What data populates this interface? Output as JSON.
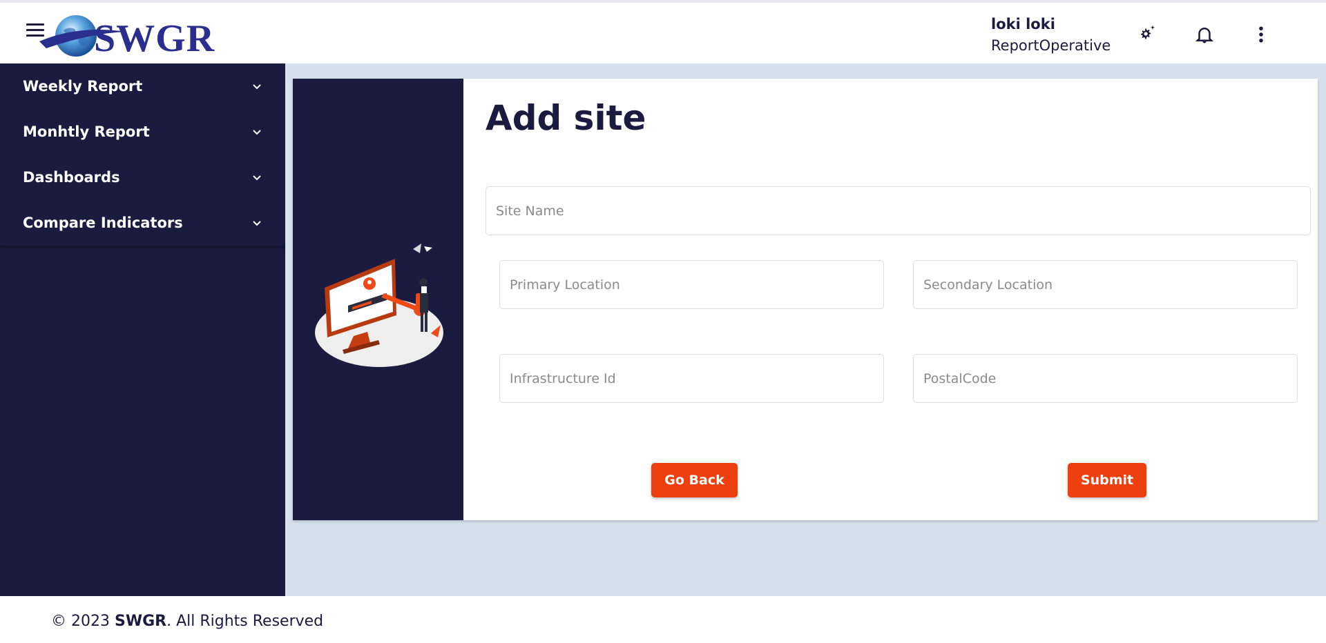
{
  "header": {
    "logo_text": "SWGR",
    "user_name": "loki loki",
    "user_role": "ReportOperative",
    "icons": [
      "menu-icon",
      "settings-icon",
      "notification-bell-icon",
      "more-vert-icon"
    ]
  },
  "sidebar": {
    "items": [
      {
        "label": "Weekly Report"
      },
      {
        "label": "Monhtly Report"
      },
      {
        "label": "Dashboards"
      },
      {
        "label": "Compare Indicators"
      }
    ]
  },
  "form": {
    "title": "Add site",
    "site_name_placeholder": "Site Name",
    "primary_location_placeholder": "Primary Location",
    "secondary_location_placeholder": "Secondary Location",
    "infrastructure_id_placeholder": "Infrastructure Id",
    "postal_code_placeholder": "PostalCode",
    "go_back_label": "Go Back",
    "submit_label": "Submit"
  },
  "footer": {
    "prefix": "© 2023 ",
    "brand": "SWGR",
    "suffix": ". All Rights Reserved"
  },
  "colors": {
    "navy": "#1b1a3f",
    "accent": "#ee3f0e",
    "background": "#d6e1ee"
  }
}
